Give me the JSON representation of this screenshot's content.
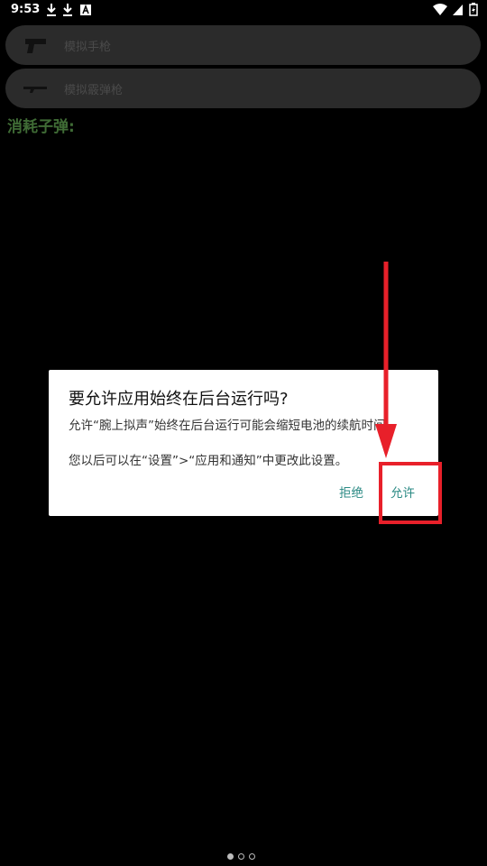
{
  "status_bar": {
    "time": "9:53",
    "icons_left": [
      "download-icon",
      "download-icon",
      "app-notification-icon"
    ],
    "icons_right": [
      "wifi-icon",
      "signal-icon",
      "battery-icon"
    ]
  },
  "menu": {
    "items": [
      {
        "label": "模拟手枪",
        "icon": "pistol-icon"
      },
      {
        "label": "模拟霰弹枪",
        "icon": "shotgun-icon"
      }
    ]
  },
  "bullets_consumed_label": "消耗子弹:",
  "dialog": {
    "title": "要允许应用始终在后台运行吗?",
    "message_1": "允许“腕上拟声”始终在后台运行可能会缩短电池的续航时间。",
    "message_2": "您以后可以在“设置”>“应用和通知”中更改此设置。",
    "deny_label": "拒绝",
    "allow_label": "允许"
  },
  "annotation": {
    "color": "#e8202a"
  },
  "colors": {
    "background": "#000000",
    "pill": "#2b2b2b",
    "accent_button": "#2b8a84",
    "label_green": "#3f6b35"
  },
  "page_indicator": {
    "count": 3,
    "active": 0
  }
}
